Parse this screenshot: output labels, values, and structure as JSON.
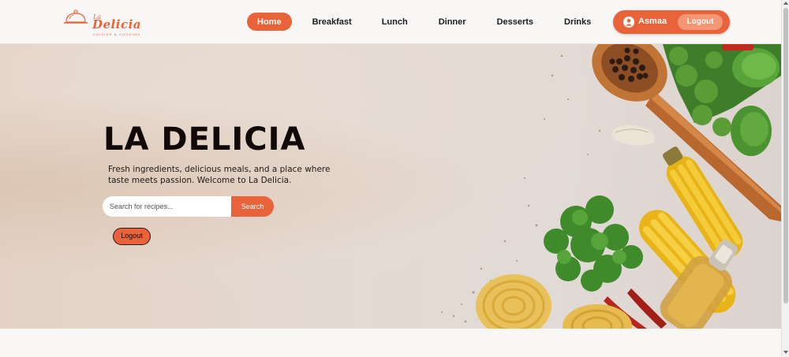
{
  "brand": {
    "small": "La",
    "name": "Delicia",
    "tagline": "CUISINE & COOKING"
  },
  "nav": {
    "items": [
      {
        "label": "Home",
        "active": true
      },
      {
        "label": "Breakfast",
        "active": false
      },
      {
        "label": "Lunch",
        "active": false
      },
      {
        "label": "Dinner",
        "active": false
      },
      {
        "label": "Desserts",
        "active": false
      },
      {
        "label": "Drinks",
        "active": false
      }
    ]
  },
  "user": {
    "name": "Asmaa",
    "logout_label": "Logout",
    "icon": "user-circle-icon"
  },
  "hero": {
    "title": "LA DELICIA",
    "description": "Fresh ingredients, delicious meals, and a place where taste meets passion. Welcome to La Delicia.",
    "search": {
      "placeholder": "Search for recipes...",
      "value": "",
      "button_label": "Search"
    },
    "logout_label": "Logout"
  },
  "colors": {
    "accent": "#e8623a",
    "accent_light": "#f39674",
    "title": "#120808"
  }
}
